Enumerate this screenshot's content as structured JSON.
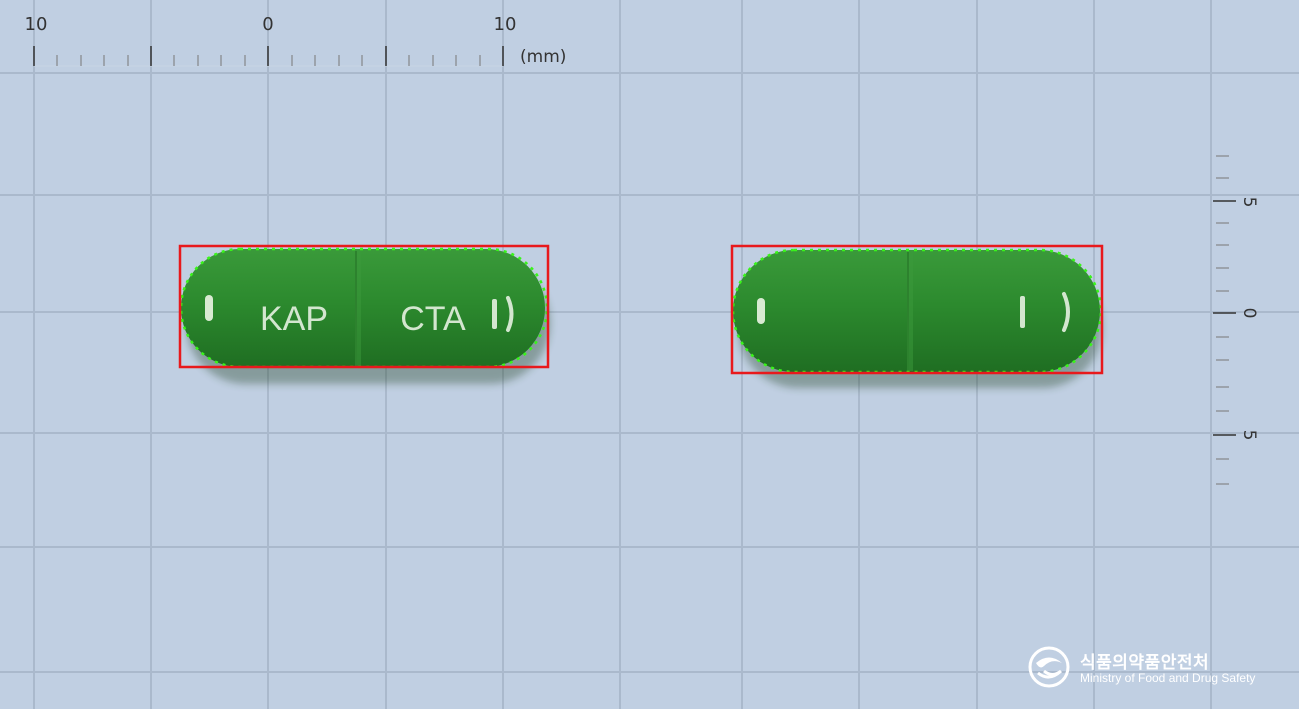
{
  "ruler_top": {
    "labels": [
      "10",
      "0",
      "10"
    ],
    "unit": "(mm)"
  },
  "ruler_right": {
    "labels": [
      "5",
      "0",
      "5"
    ]
  },
  "pills": [
    {
      "imprint_body": "KAP",
      "imprint_cap": "CTA",
      "color": "#2a8a2c"
    },
    {
      "imprint_body": "",
      "imprint_cap": "",
      "color": "#2a8a2c"
    }
  ],
  "logo": {
    "korean": "식품의약품안전처",
    "english": "Ministry of Food and Drug Safety"
  },
  "colors": {
    "background": "#c0cfe2",
    "grid": "#a9b7c9",
    "bbox": "#e8191c",
    "contour": "#39f51a",
    "capsule": "#2a8a2c"
  }
}
